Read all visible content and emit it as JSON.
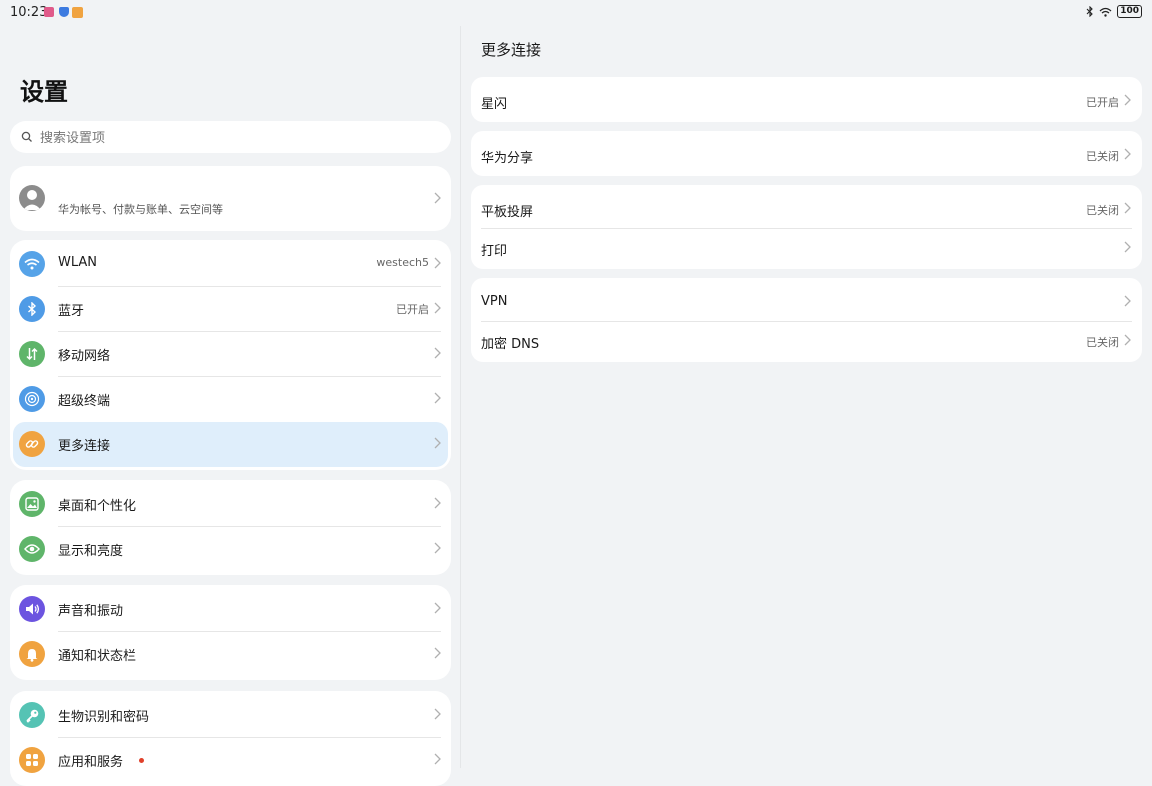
{
  "status": {
    "time": "10:23",
    "battery": "100"
  },
  "left": {
    "title": "设置",
    "search": {
      "placeholder": "搜索设置项"
    },
    "account": {
      "subtitle": "华为帐号、付款与账单、云空间等"
    },
    "groups": [
      [
        {
          "label": "WLAN",
          "value": "westech5",
          "icon": "wifi-icon",
          "color": "#56a3e8"
        },
        {
          "label": "蓝牙",
          "value": "已开启",
          "icon": "bluetooth-icon",
          "color": "#4f9be6"
        },
        {
          "label": "移动网络",
          "value": "",
          "icon": "mobile-data-icon",
          "color": "#5fb56a"
        },
        {
          "label": "超级终端",
          "value": "",
          "icon": "super-device-icon",
          "color": "#4f9be6"
        },
        {
          "label": "更多连接",
          "value": "",
          "icon": "link-icon",
          "color": "#f0a340",
          "selected": true
        }
      ],
      [
        {
          "label": "桌面和个性化",
          "value": "",
          "icon": "wallpaper-icon",
          "color": "#5fb56a"
        },
        {
          "label": "显示和亮度",
          "value": "",
          "icon": "eye-icon",
          "color": "#5fb56a"
        }
      ],
      [
        {
          "label": "声音和振动",
          "value": "",
          "icon": "speaker-icon",
          "color": "#6c54e0"
        },
        {
          "label": "通知和状态栏",
          "value": "",
          "icon": "bell-icon",
          "color": "#f0a340"
        }
      ],
      [
        {
          "label": "生物识别和密码",
          "value": "",
          "icon": "key-icon",
          "color": "#55c3b4"
        },
        {
          "label": "应用和服务",
          "value": "",
          "icon": "apps-icon",
          "color": "#f0a340",
          "badge": true
        }
      ]
    ]
  },
  "right": {
    "title": "更多连接",
    "groups": [
      [
        {
          "label": "星闪",
          "value": "已开启"
        }
      ],
      [
        {
          "label": "华为分享",
          "value": "已关闭"
        }
      ],
      [
        {
          "label": "平板投屏",
          "value": "已关闭"
        },
        {
          "label": "打印",
          "value": ""
        }
      ],
      [
        {
          "label": "VPN",
          "value": ""
        },
        {
          "label": "加密 DNS",
          "value": "已关闭"
        }
      ]
    ]
  }
}
